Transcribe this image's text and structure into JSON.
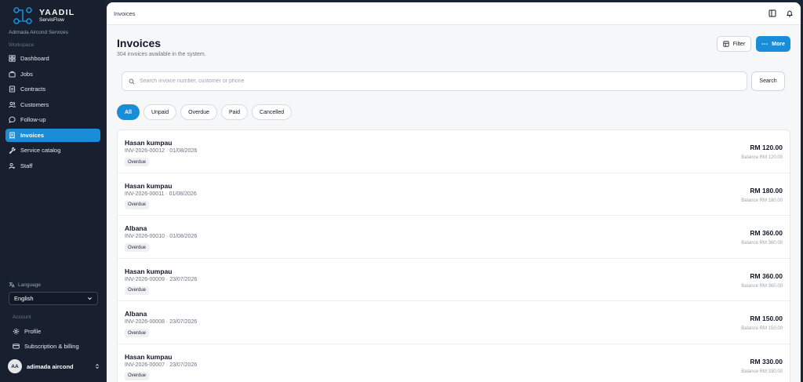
{
  "app": {
    "name": "YAADIL",
    "product": "ServisFlow",
    "company": "Adimada Aircond Services"
  },
  "sidebar": {
    "section_workspace": "Workspace",
    "items": [
      {
        "label": "Dashboard",
        "icon": "grid-icon",
        "active": false
      },
      {
        "label": "Jobs",
        "icon": "briefcase-icon",
        "active": false
      },
      {
        "label": "Contracts",
        "icon": "document-icon",
        "active": false
      },
      {
        "label": "Customers",
        "icon": "users-icon",
        "active": false
      },
      {
        "label": "Follow-up",
        "icon": "chat-icon",
        "active": false
      },
      {
        "label": "Invoices",
        "icon": "receipt-icon",
        "active": true
      },
      {
        "label": "Service catalog",
        "icon": "wrench-icon",
        "active": false
      },
      {
        "label": "Staff",
        "icon": "staff-icon",
        "active": false
      }
    ],
    "language_label": "Language",
    "language_value": "English",
    "section_account": "Account",
    "profile_label": "Profile",
    "billing_label": "Subscription & billing",
    "user": {
      "initials": "AA",
      "name": "adimada aircond"
    }
  },
  "header": {
    "breadcrumb": "Invoices"
  },
  "page": {
    "title": "Invoices",
    "subtitle": "304 invoices available in the system.",
    "filter_label": "Filter",
    "more_label": "More",
    "search_placeholder": "Search invoice number, customer or phone",
    "search_button": "Search",
    "tabs": [
      "All",
      "Unpaid",
      "Overdue",
      "Paid",
      "Cancelled"
    ],
    "active_tab": "All"
  },
  "invoices": [
    {
      "customer": "Hasan kumpau",
      "meta": "INV-2026-00012 · 01/08/2026",
      "status": "Overdue",
      "amount": "RM 120.00",
      "balance": "Balance RM 120.00"
    },
    {
      "customer": "Hasan kumpau",
      "meta": "INV-2026-00011 · 01/08/2026",
      "status": "Overdue",
      "amount": "RM 180.00",
      "balance": "Balance RM 180.00"
    },
    {
      "customer": "Albana",
      "meta": "INV-2026-00010 · 01/08/2026",
      "status": "Overdue",
      "amount": "RM 360.00",
      "balance": "Balance RM 360.00"
    },
    {
      "customer": "Hasan kumpau",
      "meta": "INV-2026-00009 · 23/07/2026",
      "status": "Overdue",
      "amount": "RM 360.00",
      "balance": "Balance RM 360.00"
    },
    {
      "customer": "Albana",
      "meta": "INV-2026-00008 · 23/07/2026",
      "status": "Overdue",
      "amount": "RM 150.00",
      "balance": "Balance RM 150.00"
    },
    {
      "customer": "Hasan kumpau",
      "meta": "INV-2026-00007 · 23/07/2026",
      "status": "Overdue",
      "amount": "RM 330.00",
      "balance": "Balance RM 330.00"
    }
  ],
  "colors": {
    "accent": "#1a8dd8",
    "sidebar_bg": "#18202f",
    "main_bg": "#f6f7f9"
  }
}
